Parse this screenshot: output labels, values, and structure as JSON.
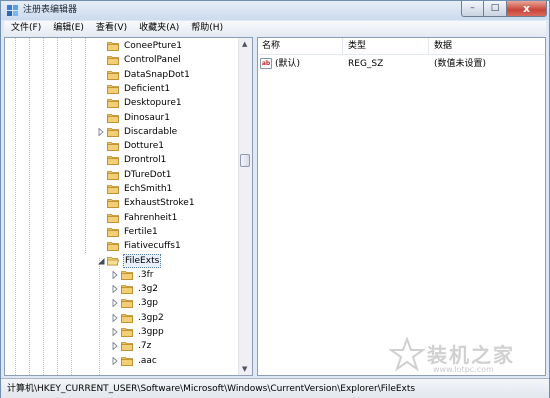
{
  "window": {
    "title": "注册表编辑器",
    "controls": {
      "minimize": "–",
      "maximize": "□",
      "close": "x"
    }
  },
  "menu": [
    "文件(F)",
    "编辑(E)",
    "查看(V)",
    "收藏夹(A)",
    "帮助(H)"
  ],
  "tree": {
    "items": [
      {
        "label": "ConeePture1",
        "expandable": false
      },
      {
        "label": "ControlPanel",
        "expandable": false
      },
      {
        "label": "DataSnapDot1",
        "expandable": false
      },
      {
        "label": "Deficient1",
        "expandable": false
      },
      {
        "label": "Desktopure1",
        "expandable": false
      },
      {
        "label": "Dinosaur1",
        "expandable": false
      },
      {
        "label": "Discardable",
        "expandable": true
      },
      {
        "label": "Dotture1",
        "expandable": false
      },
      {
        "label": "Drontrol1",
        "expandable": false
      },
      {
        "label": "DTureDot1",
        "expandable": false
      },
      {
        "label": "EchSmith1",
        "expandable": false
      },
      {
        "label": "ExhaustStroke1",
        "expandable": false
      },
      {
        "label": "Fahrenheit1",
        "expandable": false
      },
      {
        "label": "Fertile1",
        "expandable": false
      },
      {
        "label": "Fiativecuffs1",
        "expandable": false
      },
      {
        "label": "FileExts",
        "expanded": true,
        "selected": true
      }
    ],
    "children": [
      ".3fr",
      ".3g2",
      ".3gp",
      ".3gp2",
      ".3gpp",
      ".7z",
      ".aac"
    ]
  },
  "list": {
    "columns": [
      "名称",
      "类型",
      "数据"
    ],
    "rows": [
      {
        "name": "(默认)",
        "type": "REG_SZ",
        "data": "(数值未设置)"
      }
    ]
  },
  "status": "计算机\\HKEY_CURRENT_USER\\Software\\Microsoft\\Windows\\CurrentVersion\\Explorer\\FileExts",
  "watermark": {
    "text": "装机之家",
    "url": "www.lotpc.com"
  },
  "colors": {
    "folder": "#e8c063",
    "selection": "#e8f1fb",
    "titlebar": "#cbdbee"
  }
}
